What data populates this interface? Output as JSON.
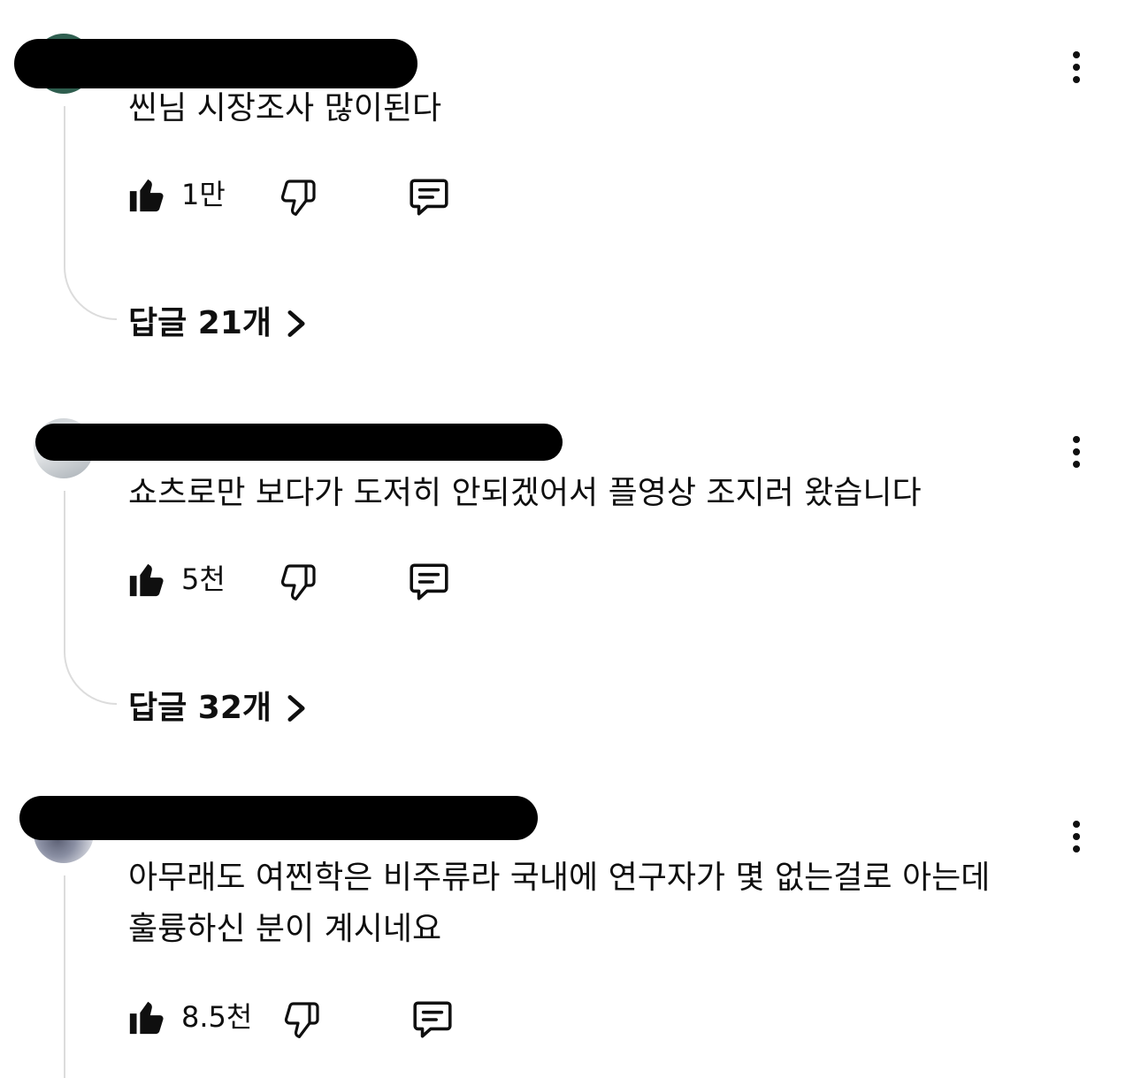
{
  "comments": [
    {
      "text_lines": [
        "씬님 시장조사 많이된다"
      ],
      "likes": "1만",
      "replies_label": "답글 21개",
      "avatar": "green-avatar"
    },
    {
      "text_lines": [
        "쇼츠로만 보다가 도저히 안되겠어서 플영상 조지러 왔습니다"
      ],
      "likes": "5천",
      "replies_label": "답글 32개",
      "avatar": "photo-avatar"
    },
    {
      "text_lines": [
        "아무래도 여찐학은 비주류라 국내에 연구자가 몇 없는걸로 아는데",
        "훌륭하신 분이 계시네요"
      ],
      "likes": "8.5천",
      "replies_label": "",
      "avatar": "pattern-avatar"
    }
  ],
  "icons": {
    "like": "thumbs-up-icon",
    "dislike": "thumbs-down-icon",
    "reply": "comment-icon",
    "more": "more-vertical-icon",
    "chevron": "chevron-right-icon"
  },
  "colors": {
    "text": "#0f0f0f",
    "thread_line": "#dcdcdc",
    "background": "#ffffff"
  }
}
